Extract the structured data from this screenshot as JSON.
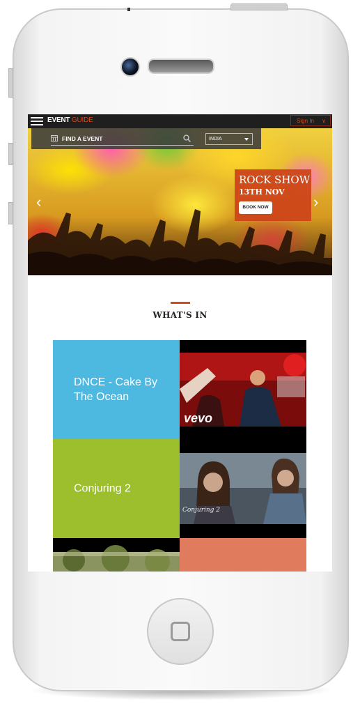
{
  "app": {
    "brand_primary": "EVENT",
    "brand_secondary": "GUIDE",
    "signin_label": "Sign In"
  },
  "search": {
    "label": "FIND A EVENT",
    "country": "INDIA"
  },
  "hero": {
    "title": "ROCK SHOW",
    "date": "13TH NOV",
    "cta": "BOOK NOW"
  },
  "section": {
    "title": "WHAT'S IN"
  },
  "tiles": [
    {
      "title": "DNCE - Cake By The Ocean",
      "color": "#4db8e0",
      "logo": "vevo"
    },
    {
      "title": "Conjuring 2",
      "color": "#9dbf2d",
      "logo": "Conjuring 2"
    }
  ],
  "colors": {
    "accent": "#d2491e",
    "topbar": "#1f1f1f",
    "tile_partial": "#e07b5e"
  },
  "icons": {
    "menu": "menu-icon",
    "calendar": "calendar-icon",
    "search": "search-icon",
    "prev": "chevron-left-icon",
    "next": "chevron-right-icon",
    "home": "home-button-icon"
  }
}
